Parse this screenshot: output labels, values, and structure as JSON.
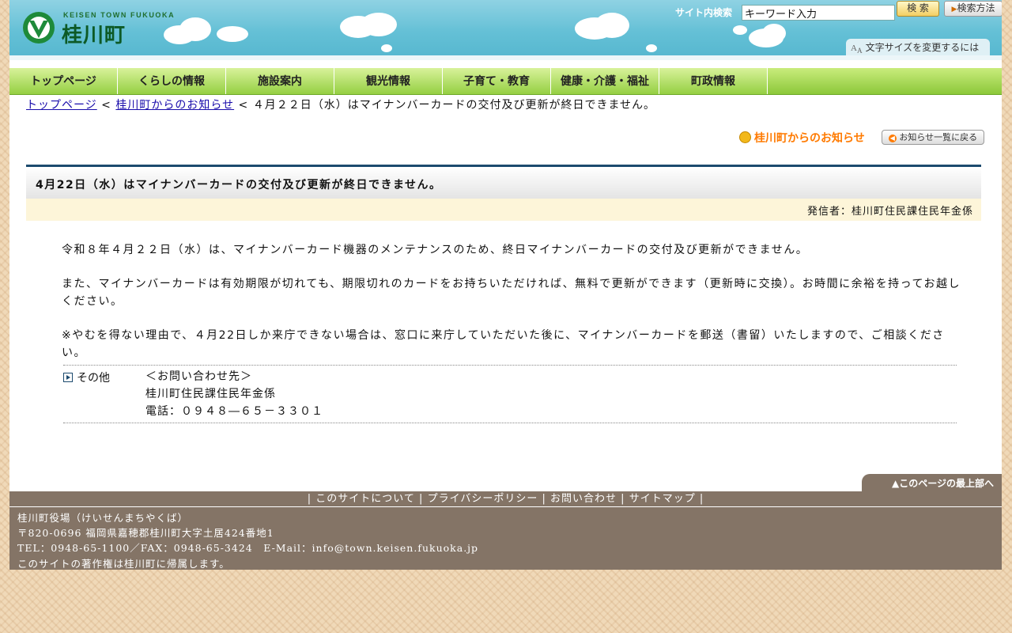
{
  "header": {
    "logo_en": "KEISEN TOWN FUKUOKA",
    "logo_jp": "桂川町",
    "search_label": "サイト内検索",
    "search_value": "キーワード入力",
    "search_button": "検 索",
    "method_button": "検索方法",
    "fontsize_link": "文字サイズを変更するには"
  },
  "nav": [
    {
      "label": "トップページ"
    },
    {
      "label": "くらしの情報"
    },
    {
      "label": "施設案内"
    },
    {
      "label": "観光情報"
    },
    {
      "label": "子育て・教育"
    },
    {
      "label": "健康・介護・福祉"
    },
    {
      "label": "町政情報"
    }
  ],
  "breadcrumb": {
    "home": "トップページ",
    "sep1": " < ",
    "section": "桂川町からのお知らせ",
    "sep2": " < ",
    "current": "４月２２日（水）はマイナンバーカードの交付及び更新が終日できません。"
  },
  "section": {
    "title": "桂川町からのお知らせ",
    "back_button": "お知らせ一覧に戻る"
  },
  "article": {
    "title": "4月22日（水）はマイナンバーカードの交付及び更新が終日できません。",
    "sender": "発信者：桂川町住民課住民年金係",
    "paragraphs": [
      "令和８年４月２２日（水）は、マイナンバーカード機器のメンテナンスのため、終日マイナンバーカードの交付及び更新ができません。",
      "また、マイナンバーカードは有効期限が切れても、期限切れのカードをお持ちいただければ、無料で更新ができます（更新時に交換）。お時間に余裕を持ってお越しください。",
      "※やむを得ない理由で、４月22日しか来庁できない場合は、窓口に来庁していただいた後に、マイナンバーカードを郵送（書留）いたしますので、ご相談ください。"
    ],
    "info_label": "その他",
    "info_lines": [
      "＜お問い合わせ先＞",
      "桂川町住民課住民年金係",
      "電話：０９４８―６５－３３０１"
    ]
  },
  "footer": {
    "pagetop": "▲このページの最上部へ",
    "links": [
      {
        "label": "このサイトについて"
      },
      {
        "label": "プライバシーポリシー"
      },
      {
        "label": "お問い合わせ"
      },
      {
        "label": "サイトマップ"
      }
    ],
    "office": "桂川町役場（けいせんまちやくば）",
    "address": "〒820-0696 福岡県嘉穂郡桂川町大字土居424番地1",
    "contact": "TEL：0948-65-1100／FAX：0948-65-3424　E-Mail：info@town.keisen.fukuoka.jp",
    "copyright": "このサイトの著作権は桂川町に帰属します。"
  },
  "colors": {
    "header": "#64c0d6",
    "nav": "#95cf42",
    "accent": "#ff7a00",
    "footer": "#847466"
  }
}
